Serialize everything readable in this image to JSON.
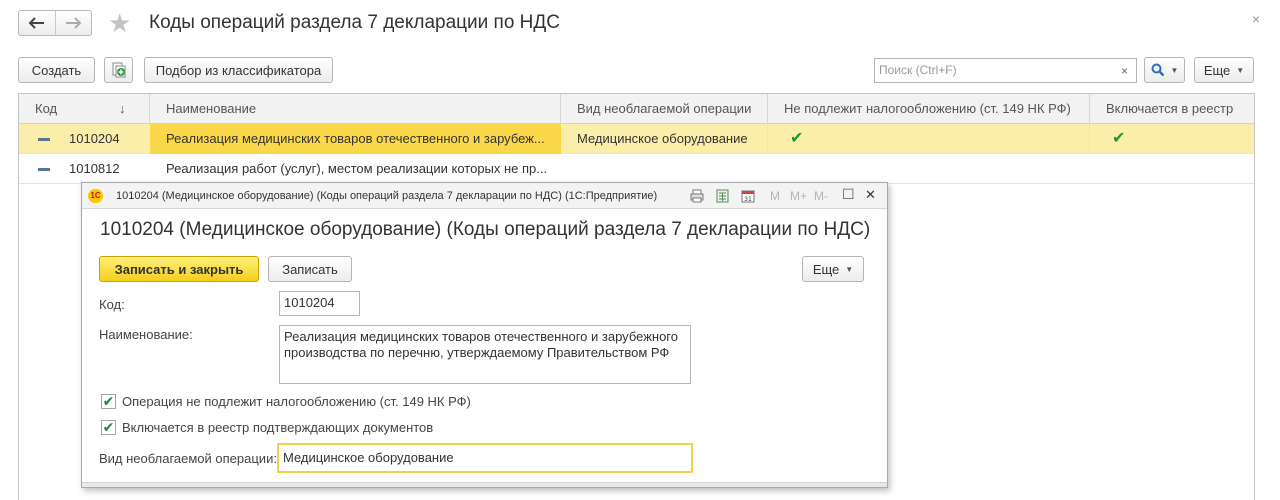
{
  "page": {
    "title": "Коды операций раздела 7 декларации по НДС",
    "close_glyph": "×"
  },
  "toolbar": {
    "create_label": "Создать",
    "pick_label": "Подбор из классификатора",
    "search_placeholder": "Поиск (Ctrl+F)",
    "clear_glyph": "×",
    "more_label": "Еще"
  },
  "table": {
    "headers": {
      "code": "Код",
      "name": "Наименование",
      "kind": "Вид необлагаемой операции",
      "not_taxable": "Не подлежит налогообложению (ст. 149 НК РФ)",
      "registry": "Включается в реестр"
    },
    "sort_glyph": "↓",
    "check_glyph": "✔",
    "rows": [
      {
        "code": "1010204",
        "name": "Реализация медицинских товаров отечественного и зарубеж...",
        "kind": "Медицинское оборудование",
        "not_taxable": true,
        "registry": true,
        "selected": true
      },
      {
        "code": "1010812",
        "name": "Реализация работ (услуг), местом реализации которых не пр...",
        "kind": "",
        "not_taxable": false,
        "registry": false,
        "selected": false
      }
    ]
  },
  "modal": {
    "logo_text": "1С",
    "caption": "1010204 (Медицинское оборудование) (Коды операций раздела 7 декларации по НДС)  (1С:Предприятие)",
    "heading": "1010204 (Медицинское оборудование) (Коды операций раздела 7 декларации по НДС)",
    "save_close_label": "Записать и закрыть",
    "save_label": "Записать",
    "more_label": "Еще",
    "tools": {
      "m": "M",
      "m_plus": "M+",
      "m_minus": "M-",
      "restore": "☐",
      "close": "✕"
    },
    "fields": {
      "code_label": "Код:",
      "code_value": "1010204",
      "name_label": "Наименование:",
      "name_value": "Реализация медицинских товаров отечественного и зарубежного производства по перечню, утверждаемому Правительством РФ",
      "not_taxable_label": "Операция не подлежит налогообложению (ст. 149 НК РФ)",
      "not_taxable_checked": true,
      "registry_label": "Включается в реестр подтверждающих документов",
      "registry_checked": true,
      "kind_label": "Вид необлагаемой операции:",
      "kind_value": "Медицинское оборудование"
    }
  },
  "colors": {
    "selected_row": "#fbeeab",
    "active_cell": "#fbd84a",
    "primary_button": "#f5cf1a",
    "check": "#1a9a2e"
  },
  "icons": [
    "arrow-left-icon",
    "arrow-right-icon",
    "star-icon",
    "close-icon",
    "copy-add-icon",
    "search-icon",
    "row-marker-icon",
    "checkmark-icon",
    "1c-logo-icon",
    "print-icon",
    "calculator-icon",
    "calendar-icon"
  ]
}
